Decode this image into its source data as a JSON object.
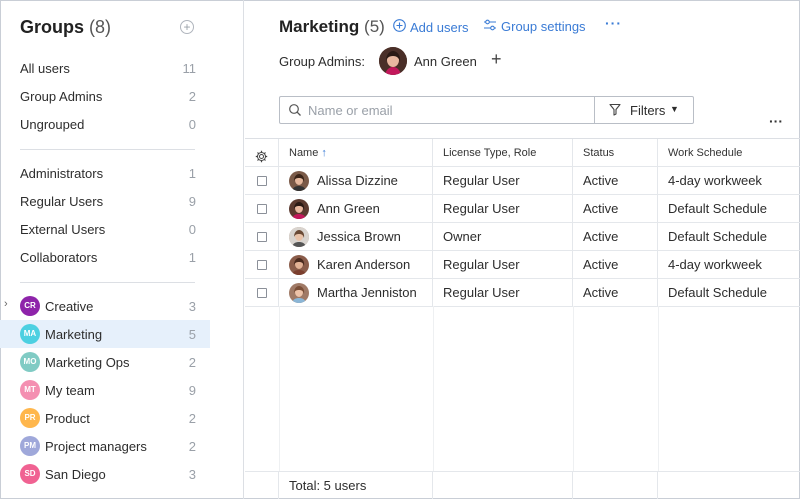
{
  "sidebar": {
    "title": "Groups",
    "title_count": "(8)",
    "system_items": [
      {
        "label": "All users",
        "count": "11"
      },
      {
        "label": "Group Admins",
        "count": "2"
      },
      {
        "label": "Ungrouped",
        "count": "0"
      }
    ],
    "role_items": [
      {
        "label": "Administrators",
        "count": "1"
      },
      {
        "label": "Regular Users",
        "count": "9"
      },
      {
        "label": "External Users",
        "count": "0"
      },
      {
        "label": "Collaborators",
        "count": "1"
      }
    ],
    "groups": [
      {
        "initials": "CR",
        "label": "Creative",
        "count": "3",
        "color": "#8e24aa",
        "expandable": true
      },
      {
        "initials": "MA",
        "label": "Marketing",
        "count": "5",
        "color": "#4dd0e1",
        "selected": true
      },
      {
        "initials": "MO",
        "label": "Marketing Ops",
        "count": "2",
        "color": "#80cbc4"
      },
      {
        "initials": "MT",
        "label": "My team",
        "count": "9",
        "color": "#f48fb1"
      },
      {
        "initials": "PR",
        "label": "Product",
        "count": "2",
        "color": "#ffb74d"
      },
      {
        "initials": "PM",
        "label": "Project managers",
        "count": "2",
        "color": "#9fa8da"
      },
      {
        "initials": "SD",
        "label": "San Diego",
        "count": "3",
        "color": "#f06292"
      }
    ]
  },
  "header": {
    "title": "Marketing",
    "count": "(5)",
    "add_users": "Add users",
    "group_settings": "Group settings",
    "more": "···",
    "admins_label": "Group Admins:",
    "admin_name": "Ann Green",
    "admin_add": "+"
  },
  "toolbar": {
    "search_placeholder": "Name or email",
    "filters_label": "Filters",
    "more": "···"
  },
  "table": {
    "columns": [
      "Name",
      "License Type, Role",
      "Status",
      "Work Schedule"
    ],
    "sort_indicator": "↑",
    "rows": [
      {
        "name": "Alissa Dizzine",
        "role": "Regular User",
        "status": "Active",
        "schedule": "4-day workweek",
        "avatar_color": "#7a5a48"
      },
      {
        "name": "Ann Green",
        "role": "Regular User",
        "status": "Active",
        "schedule": "Default Schedule",
        "avatar_color": "#5b3a30"
      },
      {
        "name": "Jessica Brown",
        "role": "Owner",
        "status": "Active",
        "schedule": "Default Schedule",
        "avatar_color": "#b08f7a"
      },
      {
        "name": "Karen Anderson",
        "role": "Regular User",
        "status": "Active",
        "schedule": "4-day workweek",
        "avatar_color": "#8a5c4a"
      },
      {
        "name": "Martha Jenniston",
        "role": "Regular User",
        "status": "Active",
        "schedule": "Default Schedule",
        "avatar_color": "#a07a66"
      }
    ],
    "footer": "Total: 5 users"
  }
}
